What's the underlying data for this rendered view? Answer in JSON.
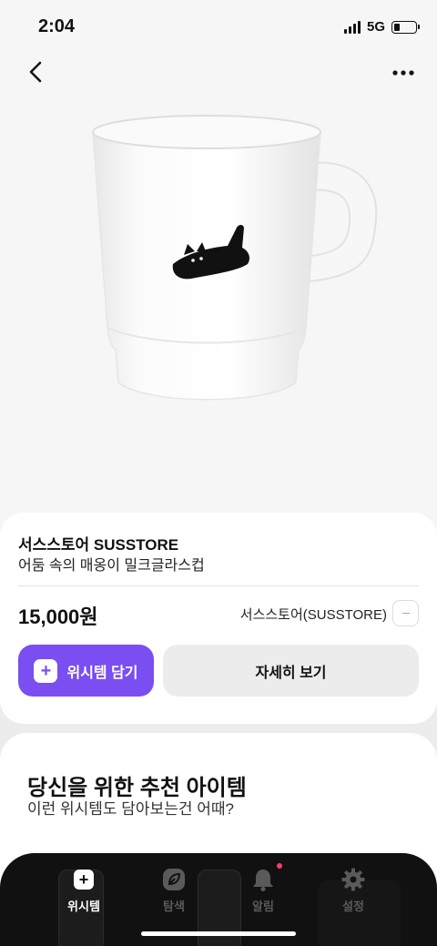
{
  "status_bar": {
    "time": "2:04",
    "network": "5G",
    "battery_level": 0.25
  },
  "nav": {
    "back_icon": "chevron-left-icon",
    "more_icon": "more-horizontal-icon"
  },
  "product": {
    "brand": "서스스토어 SUSSTORE",
    "name": "어둠 속의 매옹이 밀크글라스컵",
    "price": "15,000원",
    "seller": "서스스토어(SUSSTORE)"
  },
  "actions": {
    "wish_label": "위시템 담기",
    "detail_label": "자세히 보기"
  },
  "recommend": {
    "title": "당신을 위한 추천 아이템",
    "subtitle": "이런 위시템도 담아보는건 어때?"
  },
  "tabs": [
    {
      "label": "위시템",
      "icon": "add-icon",
      "active": true
    },
    {
      "label": "탐색",
      "icon": "leaf-icon",
      "active": false
    },
    {
      "label": "알림",
      "icon": "bell-icon",
      "active": false,
      "badge": true
    },
    {
      "label": "설정",
      "icon": "gear-icon",
      "active": false
    }
  ],
  "colors": {
    "accent": "#7a4ef0",
    "badge": "#ff3b69"
  }
}
